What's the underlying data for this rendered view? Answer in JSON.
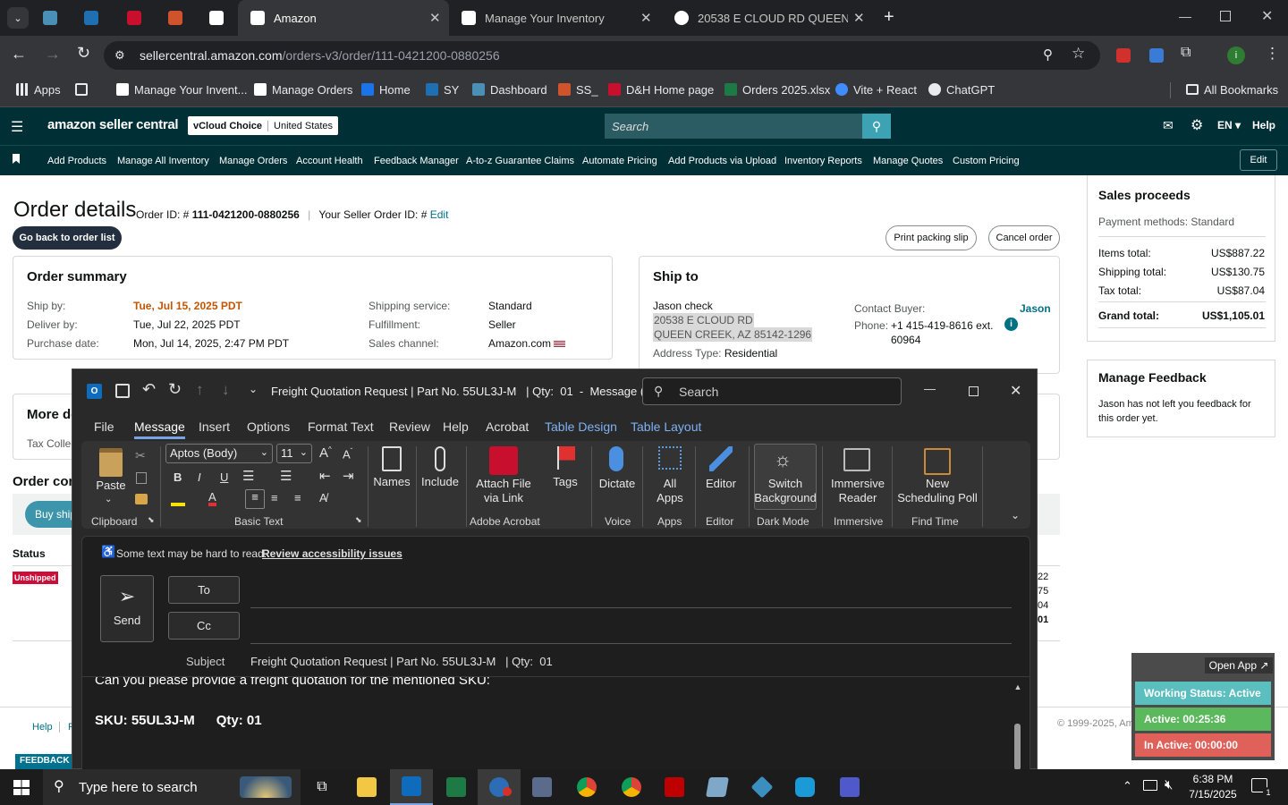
{
  "browser": {
    "tabs": [
      {
        "label": "Amazon",
        "active": true
      },
      {
        "label": "Manage Your Inventory",
        "active": false
      },
      {
        "label": "20538 E CLOUD RD QUEEN CRE",
        "active": false
      }
    ],
    "url_domain": "sellercentral.amazon.com",
    "url_path": "/orders-v3/order/111-0421200-0880256",
    "bookmarks": [
      "Apps",
      "Manage Your Invent...",
      "Manage Orders",
      "Home",
      "SY",
      "Dashboard",
      "SS_",
      "D&H Home page",
      "Orders 2025.xlsx",
      "Vite + React",
      "ChatGPT"
    ],
    "all_bookmarks": "All Bookmarks"
  },
  "sc": {
    "logo": "amazon seller central",
    "account_name": "vCloud Choice",
    "account_region": "United States",
    "search_placeholder": "Search",
    "lang": "EN",
    "help": "Help",
    "nav": [
      "Add Products",
      "Manage All Inventory",
      "Manage Orders",
      "Account Health",
      "Feedback Manager",
      "A-to-z Guarantee Claims",
      "Automate Pricing",
      "Add Products via Upload",
      "Inventory Reports",
      "Manage Quotes",
      "Custom Pricing"
    ],
    "nav_edit": "Edit"
  },
  "order": {
    "title": "Order details",
    "order_id_label": "Order ID: #",
    "order_id": "111-0421200-0880256",
    "seller_order_label": "Your Seller Order ID: #",
    "edit": "Edit",
    "back_button": "Go back to order list",
    "print_button": "Print packing slip",
    "cancel_button": "Cancel order",
    "summary_title": "Order summary",
    "ship_by_label": "Ship by:",
    "ship_by": "Tue, Jul 15, 2025 PDT",
    "deliver_by_label": "Deliver by:",
    "deliver_by": "Tue, Jul 22, 2025 PDT",
    "purchase_date_label": "Purchase date:",
    "purchase_date": "Mon, Jul 14, 2025, 2:47 PM PDT",
    "shipping_service_label": "Shipping service:",
    "shipping_service": "Standard",
    "fulfillment_label": "Fulfillment:",
    "fulfillment": "Seller",
    "sales_channel_label": "Sales channel:",
    "sales_channel": "Amazon.com",
    "ship_to_title": "Ship to",
    "ship_name": "Jason check",
    "ship_addr1": "20538 E CLOUD RD",
    "ship_addr2": "QUEEN CREEK, AZ 85142-1296",
    "address_type_label": "Address Type:",
    "address_type": "Residential",
    "contact_label": "Contact Buyer:",
    "contact_name": "Jason",
    "phone_label": "Phone:",
    "phone": "+1 415-419-8616 ext.",
    "phone_ext": "60964",
    "more_details": "More de",
    "tax_collected": "Tax Collec",
    "order_contents": "Order con",
    "buy_shipping": "Buy shipp",
    "status_label": "Status",
    "status_badge": "Unshipped",
    "right_partial": [
      "22",
      "75",
      "04",
      "01"
    ]
  },
  "proceeds": {
    "title": "Sales proceeds",
    "payment_methods": "Payment methods: Standard",
    "items_total_label": "Items total:",
    "items_total": "US$887.22",
    "shipping_total_label": "Shipping total:",
    "shipping_total": "US$130.75",
    "tax_total_label": "Tax total:",
    "tax_total": "US$87.04",
    "grand_total_label": "Grand total:",
    "grand_total": "US$1,105.01"
  },
  "feedback": {
    "title": "Manage Feedback",
    "text": "Jason has not left you feedback for this order yet."
  },
  "footer": {
    "help": "Help",
    "p": "P",
    "copyright": "© 1999-2025, Am",
    "feedback_tab": "FEEDBACK"
  },
  "outlook": {
    "title": "Freight Quotation Request | Part No. 55UL3J-M   | Qty:  01  -  Message (...",
    "search_placeholder": "Search",
    "menu": [
      "File",
      "Message",
      "Insert",
      "Options",
      "Format Text",
      "Review",
      "Help",
      "Acrobat",
      "Table Design",
      "Table Layout"
    ],
    "font_name": "Aptos (Body)",
    "font_size": "11",
    "ribbon": {
      "paste": "Paste",
      "names": "Names",
      "include": "Include",
      "attach_file": "Attach File",
      "via_link": "via Link",
      "tags": "Tags",
      "dictate": "Dictate",
      "all": "All",
      "apps": "Apps",
      "editor": "Editor",
      "switch": "Switch",
      "background": "Background",
      "immersive": "Immersive",
      "reader": "Reader",
      "new": "New",
      "scheduling_poll": "Scheduling Poll"
    },
    "groups": [
      "Clipboard",
      "Basic Text",
      "Adobe Acrobat",
      "Voice",
      "Apps",
      "Editor",
      "Dark Mode",
      "Immersive",
      "Find Time"
    ],
    "accessibility_note": "Some text may be hard to read.",
    "accessibility_link": "Review accessibility issues",
    "send": "Send",
    "to": "To",
    "cc": "Cc",
    "subject_label": "Subject",
    "subject": "Freight Quotation Request | Part No. 55UL3J-M   | Qty:  01",
    "body_line1": "Can you please provide a freight quotation for the mentioned SKU:",
    "body_sku": "SKU: 55UL3J-M",
    "body_qty": "Qty: 01"
  },
  "widget": {
    "open_app": "Open App ↗",
    "working_status": "Working Status: Active",
    "active": "Active: 00:25:36",
    "inactive": "In Active: 00:00:00"
  },
  "taskbar": {
    "search_placeholder": "Type here to search",
    "time": "6:38 PM",
    "date": "7/15/2025",
    "notification_count": "1"
  },
  "colors": {
    "sc_header": "#002f36",
    "ship_by_orange": "#c45500",
    "link_blue": "#007185",
    "unshipped_red": "#cc0c39",
    "widget_green": "#5cb85c",
    "widget_red": "#e0605a",
    "widget_teal": "#5bbfc0"
  }
}
